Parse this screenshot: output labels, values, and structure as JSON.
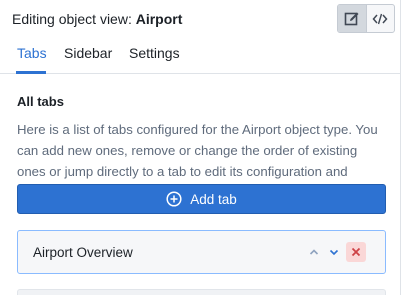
{
  "header": {
    "prefix": "Editing object view: ",
    "object_name": "Airport",
    "modes": [
      {
        "name": "edit-mode",
        "icon": "edit-icon",
        "active": true
      },
      {
        "name": "code-mode",
        "icon": "code-icon",
        "active": false
      }
    ]
  },
  "tabs": [
    {
      "label": "Tabs",
      "active": true
    },
    {
      "label": "Sidebar",
      "active": false
    },
    {
      "label": "Settings",
      "active": false
    }
  ],
  "content": {
    "section_title": "All tabs",
    "description": "Here is a list of tabs configured for the Airport object type. You can add new ones, remove or change the order of existing ones or jump directly to a tab to edit its configuration and widgets.",
    "add_button_label": "Add tab",
    "add_button_icon": "plus-circle-icon",
    "tab_list": [
      {
        "label": "Airport Overview",
        "actions": [
          "chevron-up-icon",
          "chevron-down-icon",
          "delete-icon"
        ]
      }
    ]
  },
  "colors": {
    "accent": "#2d72d2",
    "delete": "#cd4246",
    "delete_bg": "#fad7d7",
    "card_border": "#8abbff"
  }
}
